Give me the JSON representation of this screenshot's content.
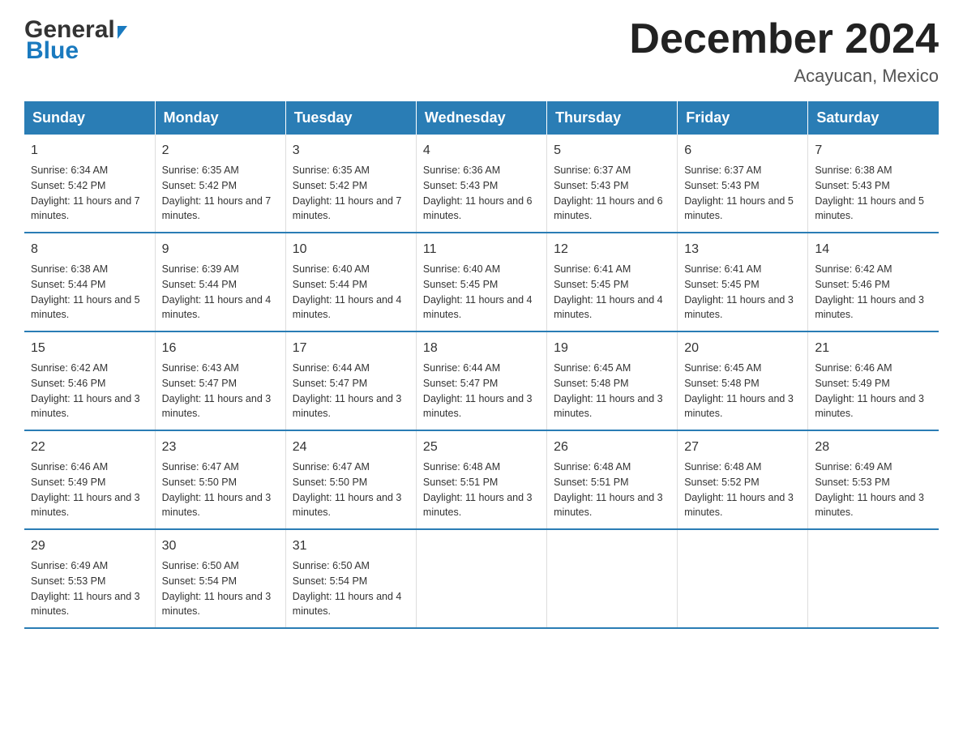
{
  "header": {
    "logo_general": "General",
    "logo_blue": "Blue",
    "month_title": "December 2024",
    "location": "Acayucan, Mexico"
  },
  "days_of_week": [
    "Sunday",
    "Monday",
    "Tuesday",
    "Wednesday",
    "Thursday",
    "Friday",
    "Saturday"
  ],
  "weeks": [
    [
      {
        "day": "1",
        "sunrise": "6:34 AM",
        "sunset": "5:42 PM",
        "daylight": "11 hours and 7 minutes."
      },
      {
        "day": "2",
        "sunrise": "6:35 AM",
        "sunset": "5:42 PM",
        "daylight": "11 hours and 7 minutes."
      },
      {
        "day": "3",
        "sunrise": "6:35 AM",
        "sunset": "5:42 PM",
        "daylight": "11 hours and 7 minutes."
      },
      {
        "day": "4",
        "sunrise": "6:36 AM",
        "sunset": "5:43 PM",
        "daylight": "11 hours and 6 minutes."
      },
      {
        "day": "5",
        "sunrise": "6:37 AM",
        "sunset": "5:43 PM",
        "daylight": "11 hours and 6 minutes."
      },
      {
        "day": "6",
        "sunrise": "6:37 AM",
        "sunset": "5:43 PM",
        "daylight": "11 hours and 5 minutes."
      },
      {
        "day": "7",
        "sunrise": "6:38 AM",
        "sunset": "5:43 PM",
        "daylight": "11 hours and 5 minutes."
      }
    ],
    [
      {
        "day": "8",
        "sunrise": "6:38 AM",
        "sunset": "5:44 PM",
        "daylight": "11 hours and 5 minutes."
      },
      {
        "day": "9",
        "sunrise": "6:39 AM",
        "sunset": "5:44 PM",
        "daylight": "11 hours and 4 minutes."
      },
      {
        "day": "10",
        "sunrise": "6:40 AM",
        "sunset": "5:44 PM",
        "daylight": "11 hours and 4 minutes."
      },
      {
        "day": "11",
        "sunrise": "6:40 AM",
        "sunset": "5:45 PM",
        "daylight": "11 hours and 4 minutes."
      },
      {
        "day": "12",
        "sunrise": "6:41 AM",
        "sunset": "5:45 PM",
        "daylight": "11 hours and 4 minutes."
      },
      {
        "day": "13",
        "sunrise": "6:41 AM",
        "sunset": "5:45 PM",
        "daylight": "11 hours and 3 minutes."
      },
      {
        "day": "14",
        "sunrise": "6:42 AM",
        "sunset": "5:46 PM",
        "daylight": "11 hours and 3 minutes."
      }
    ],
    [
      {
        "day": "15",
        "sunrise": "6:42 AM",
        "sunset": "5:46 PM",
        "daylight": "11 hours and 3 minutes."
      },
      {
        "day": "16",
        "sunrise": "6:43 AM",
        "sunset": "5:47 PM",
        "daylight": "11 hours and 3 minutes."
      },
      {
        "day": "17",
        "sunrise": "6:44 AM",
        "sunset": "5:47 PM",
        "daylight": "11 hours and 3 minutes."
      },
      {
        "day": "18",
        "sunrise": "6:44 AM",
        "sunset": "5:47 PM",
        "daylight": "11 hours and 3 minutes."
      },
      {
        "day": "19",
        "sunrise": "6:45 AM",
        "sunset": "5:48 PM",
        "daylight": "11 hours and 3 minutes."
      },
      {
        "day": "20",
        "sunrise": "6:45 AM",
        "sunset": "5:48 PM",
        "daylight": "11 hours and 3 minutes."
      },
      {
        "day": "21",
        "sunrise": "6:46 AM",
        "sunset": "5:49 PM",
        "daylight": "11 hours and 3 minutes."
      }
    ],
    [
      {
        "day": "22",
        "sunrise": "6:46 AM",
        "sunset": "5:49 PM",
        "daylight": "11 hours and 3 minutes."
      },
      {
        "day": "23",
        "sunrise": "6:47 AM",
        "sunset": "5:50 PM",
        "daylight": "11 hours and 3 minutes."
      },
      {
        "day": "24",
        "sunrise": "6:47 AM",
        "sunset": "5:50 PM",
        "daylight": "11 hours and 3 minutes."
      },
      {
        "day": "25",
        "sunrise": "6:48 AM",
        "sunset": "5:51 PM",
        "daylight": "11 hours and 3 minutes."
      },
      {
        "day": "26",
        "sunrise": "6:48 AM",
        "sunset": "5:51 PM",
        "daylight": "11 hours and 3 minutes."
      },
      {
        "day": "27",
        "sunrise": "6:48 AM",
        "sunset": "5:52 PM",
        "daylight": "11 hours and 3 minutes."
      },
      {
        "day": "28",
        "sunrise": "6:49 AM",
        "sunset": "5:53 PM",
        "daylight": "11 hours and 3 minutes."
      }
    ],
    [
      {
        "day": "29",
        "sunrise": "6:49 AM",
        "sunset": "5:53 PM",
        "daylight": "11 hours and 3 minutes."
      },
      {
        "day": "30",
        "sunrise": "6:50 AM",
        "sunset": "5:54 PM",
        "daylight": "11 hours and 3 minutes."
      },
      {
        "day": "31",
        "sunrise": "6:50 AM",
        "sunset": "5:54 PM",
        "daylight": "11 hours and 4 minutes."
      },
      {
        "day": "",
        "sunrise": "",
        "sunset": "",
        "daylight": ""
      },
      {
        "day": "",
        "sunrise": "",
        "sunset": "",
        "daylight": ""
      },
      {
        "day": "",
        "sunrise": "",
        "sunset": "",
        "daylight": ""
      },
      {
        "day": "",
        "sunrise": "",
        "sunset": "",
        "daylight": ""
      }
    ]
  ],
  "labels": {
    "sunrise": "Sunrise:",
    "sunset": "Sunset:",
    "daylight": "Daylight:"
  }
}
